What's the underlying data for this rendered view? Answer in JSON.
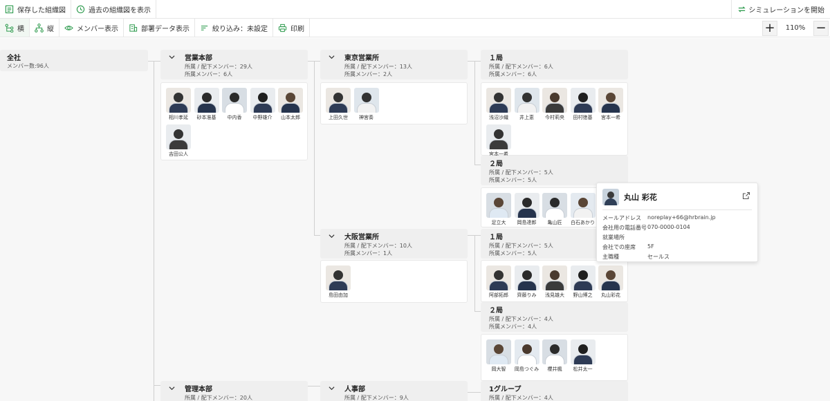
{
  "toolbar_top": {
    "saved_chart": "保存した組織図",
    "past_chart": "過去の組織図を表示",
    "simulation": "シミュレーションを開始"
  },
  "toolbar_second": {
    "horizontal": "横",
    "vertical": "縦",
    "member_display": "メンバー表示",
    "dept_data": "部署データ表示",
    "filter": "絞り込み：未設定",
    "print": "印刷",
    "zoom": "110%",
    "zoom_in": "+",
    "zoom_out": "−"
  },
  "colors": {
    "accent": "#2e9b4e",
    "node_bg": "#efefef",
    "canvas_bg": "#f7f7f7"
  },
  "nodes": {
    "root": {
      "title": "全社",
      "line1": "メンバー数:96人"
    },
    "sales_hq": {
      "title": "営業本部",
      "line1": "所属 / 配下メンバー：29人",
      "line2": "所属メンバー：6人"
    },
    "tokyo": {
      "title": "東京営業所",
      "line1": "所属 / 配下メンバー：13人",
      "line2": "所属メンバー：2人"
    },
    "tokyo_1": {
      "title": "１局",
      "line1": "所属 / 配下メンバー：6人",
      "line2": "所属メンバー：6人"
    },
    "tokyo_2": {
      "title": "２局",
      "line1": "所属 / 配下メンバー：5人",
      "line2": "所属メンバー：5人"
    },
    "osaka": {
      "title": "大阪営業所",
      "line1": "所属 / 配下メンバー：10人",
      "line2": "所属メンバー：1人"
    },
    "osaka_1": {
      "title": "１局",
      "line1": "所属 / 配下メンバー：5人",
      "line2": "所属メンバー：5人"
    },
    "osaka_2": {
      "title": "２局",
      "line1": "所属 / 配下メンバー：4人",
      "line2": "所属メンバー：4人"
    },
    "admin_hq": {
      "title": "管理本部",
      "line1": "所属 / 配下メンバー：20人"
    },
    "hr": {
      "title": "人事部",
      "line1": "所属 / 配下メンバー：9人"
    },
    "group1": {
      "title": "1グループ",
      "line1": "所属 / 配下メンバー：4人"
    }
  },
  "members": {
    "sales_hq": [
      "相川孝延",
      "砂本准基",
      "中内香",
      "中野雄介",
      "山本太郎",
      "吉田公人"
    ],
    "tokyo": [
      "上田久世",
      "神宮奏"
    ],
    "tokyo_1": [
      "浅沼沙織",
      "井上恵",
      "今村莉央",
      "田村徳基",
      "宮本一希",
      "宮本一希"
    ],
    "tokyo_2": [
      "足立大",
      "岡島達郎",
      "亀山匠",
      "白石あかり"
    ],
    "osaka": [
      "島田由加"
    ],
    "osaka_1": [
      "阿部拓郎",
      "齊藤りみ",
      "浅見雄大",
      "野山博之",
      "丸山彩花"
    ],
    "osaka_2": [
      "岡大智",
      "岡島つぐみ",
      "櫻井楓",
      "松井太一"
    ]
  },
  "popup": {
    "name": "丸山 彩花",
    "rows": [
      {
        "k": "メールアドレス",
        "v": "noreplay+66@hrbrain.jp"
      },
      {
        "k": "会社用の電話番号",
        "v": "070-0000-0104"
      },
      {
        "k": "就業場所",
        "v": ""
      },
      {
        "k": "会社での座席",
        "v": "5F"
      },
      {
        "k": "主職種",
        "v": "セールス"
      }
    ]
  }
}
